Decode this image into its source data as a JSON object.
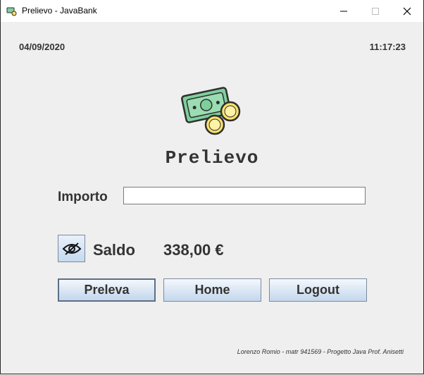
{
  "window": {
    "title": "Prelievo - JavaBank"
  },
  "header": {
    "date": "04/09/2020",
    "time": "11:17:23"
  },
  "main": {
    "heading": "Prelievo",
    "importo_label": "Importo",
    "importo_value": "",
    "saldo_label": "Saldo",
    "saldo_value": "338,00 €"
  },
  "buttons": {
    "preleva": "Preleva",
    "home": "Home",
    "logout": "Logout"
  },
  "footer": {
    "credits": "Lorenzo Romio - matr 941569 - Progetto Java Prof. Anisetti"
  },
  "icons": {
    "app": "app-icon",
    "logo": "money-icon",
    "saldo_toggle": "eye-slash-icon"
  },
  "colors": {
    "bill": "#7fcf9c",
    "coin": "#ffe36a",
    "button_top": "#f4f8fc",
    "button_bottom": "#c4d7ec"
  }
}
